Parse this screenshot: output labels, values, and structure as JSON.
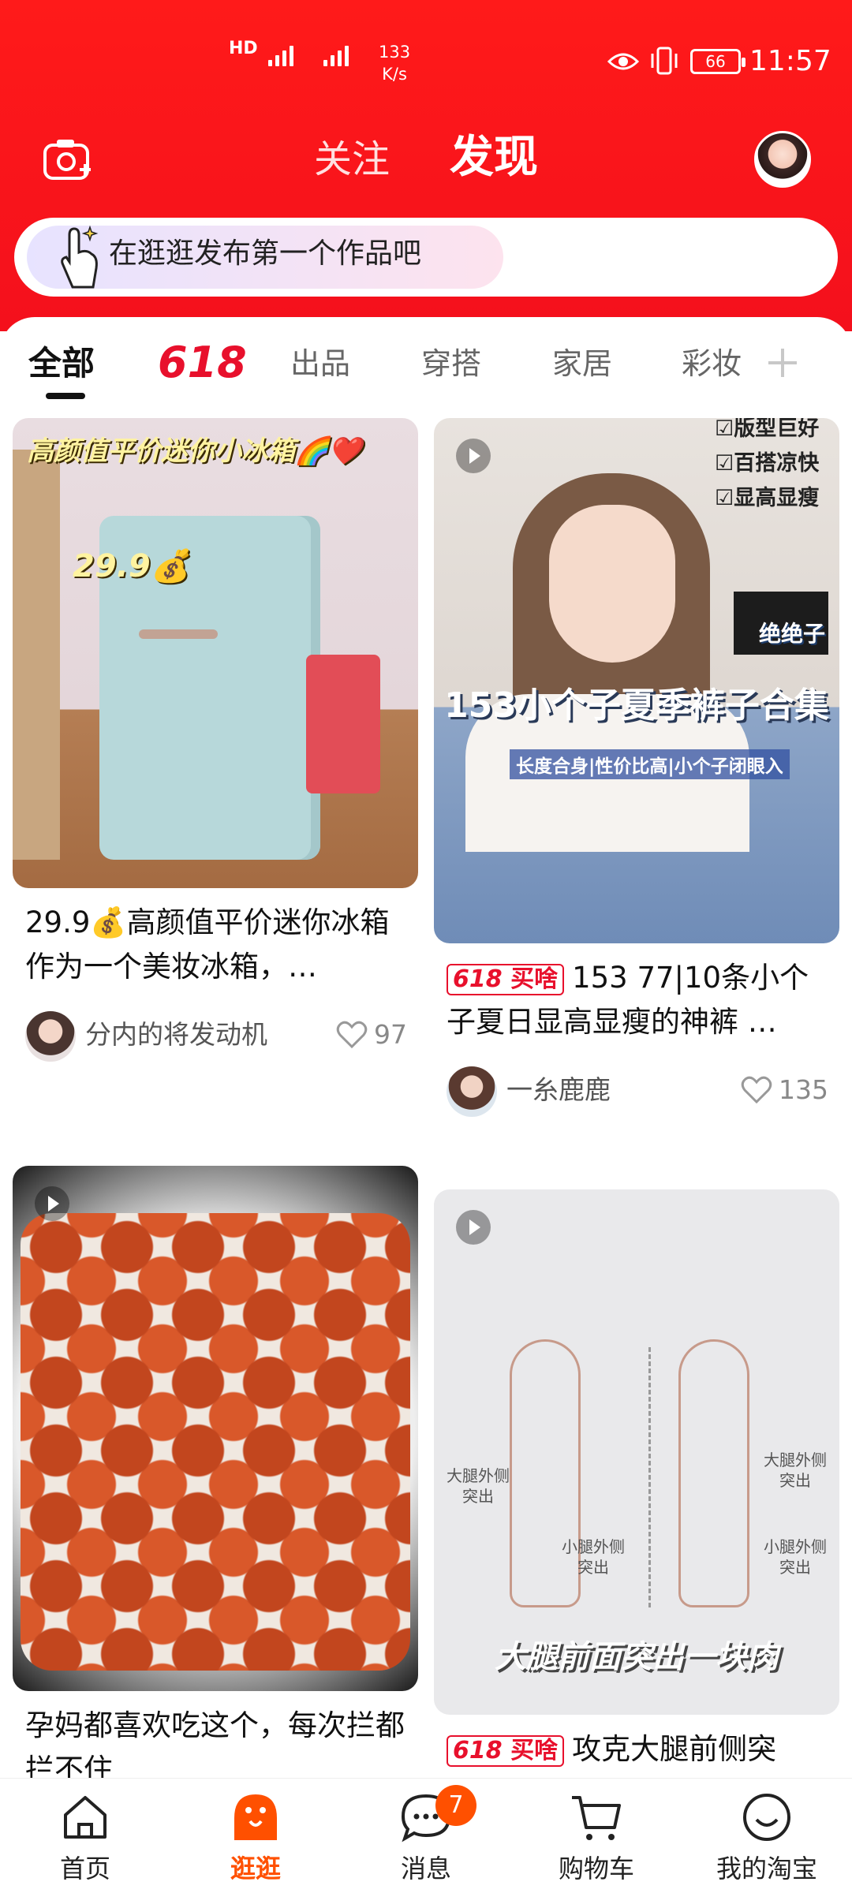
{
  "status_bar": {
    "signal": "HD",
    "speed": "133",
    "speed_unit": "K/s",
    "battery": "66",
    "time": "11:57"
  },
  "header": {
    "tab_follow": "关注",
    "tab_discover": "发现",
    "publish_prompt": "在逛逛发布第一个作品吧"
  },
  "categories": {
    "items": [
      "全部",
      "618",
      "出品",
      "穿搭",
      "家居",
      "彩妆"
    ],
    "active": "全部"
  },
  "feed": {
    "cards": [
      {
        "image_caption": "高颜值平价迷你小冰箱🌈❤️",
        "image_price": "29.9💰",
        "title": "29.9💰高颜值平价迷你冰箱 作为一个美妆冰箱，…",
        "author": "分内的将发动机",
        "likes": "97"
      },
      {
        "image_checks": [
          "☑版型巨好",
          "☑百搭凉快",
          "☑显高显瘦"
        ],
        "image_tag": "绝绝子",
        "image_big": "153小个子夏季裤子合集",
        "image_sub": "长度合身|性价比高|小个子闭眼入",
        "badge_num": "618",
        "badge_text": "买啥",
        "title": "153 77|10条小个子夏日显高显瘦的神裤 …",
        "author": "一糸鹿鹿",
        "likes": "135"
      },
      {
        "title": "孕妈都喜欢吃这个，每次拦都拦不住"
      },
      {
        "labels": [
          "大腿外侧突出",
          "小腿外侧突出",
          "大腿外侧突出",
          "小腿外侧突出"
        ],
        "image_big": "大腿前面突出一块肉",
        "badge_num": "618",
        "badge_text": "买啥",
        "title": "攻克大腿前侧突"
      }
    ]
  },
  "bottom_nav": {
    "home": "首页",
    "stroll": "逛逛",
    "messages": "消息",
    "messages_badge": "7",
    "cart": "购物车",
    "mine": "我的淘宝"
  },
  "colors": {
    "header_red": "#f4101c",
    "accent_orange": "#ff5000",
    "badge_red": "#e8102c"
  }
}
